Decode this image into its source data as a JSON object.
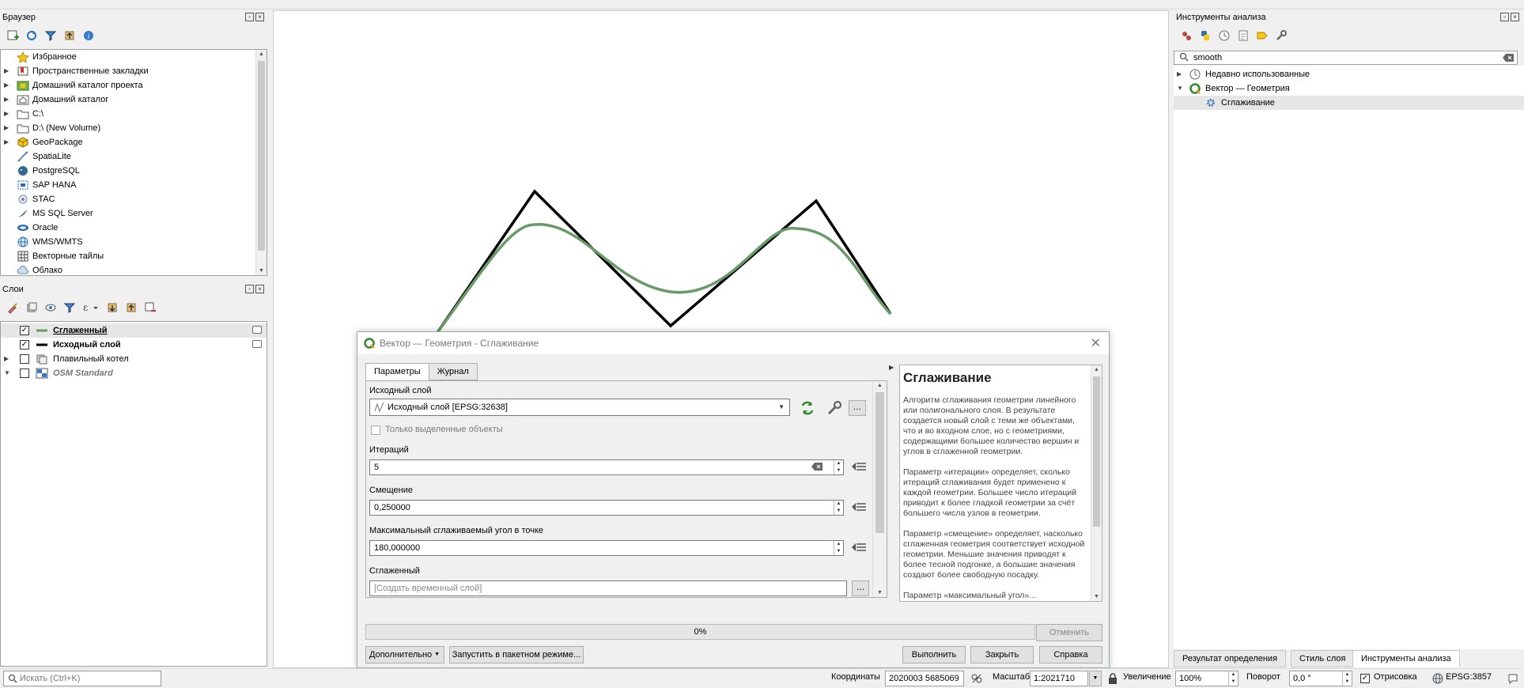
{
  "browser_panel": {
    "title": "Браузер",
    "items": [
      {
        "label": "Избранное",
        "icon": "star-icon",
        "arrow": ""
      },
      {
        "label": "Пространственные закладки",
        "icon": "bookmarks-icon",
        "arrow": "▶"
      },
      {
        "label": "Домашний каталог проекта",
        "icon": "project-home-icon",
        "arrow": "▶"
      },
      {
        "label": "Домашний каталог",
        "icon": "home-folder-icon",
        "arrow": "▶"
      },
      {
        "label": "C:\\",
        "icon": "folder-icon",
        "arrow": "▶"
      },
      {
        "label": "D:\\ (New Volume)",
        "icon": "folder-icon",
        "arrow": "▶"
      },
      {
        "label": "GeoPackage",
        "icon": "geopackage-icon",
        "arrow": "▶"
      },
      {
        "label": "SpatiaLite",
        "icon": "spatialite-icon",
        "arrow": ""
      },
      {
        "label": "PostgreSQL",
        "icon": "postgresql-icon",
        "arrow": ""
      },
      {
        "label": "SAP HANA",
        "icon": "sap-hana-icon",
        "arrow": ""
      },
      {
        "label": "STAC",
        "icon": "stac-icon",
        "arrow": ""
      },
      {
        "label": "MS SQL Server",
        "icon": "mssql-icon",
        "arrow": ""
      },
      {
        "label": "Oracle",
        "icon": "oracle-icon",
        "arrow": ""
      },
      {
        "label": "WMS/WMTS",
        "icon": "wms-icon",
        "arrow": ""
      },
      {
        "label": "Векторные тайлы",
        "icon": "vector-tiles-icon",
        "arrow": ""
      },
      {
        "label": "Облако",
        "icon": "cloud-icon",
        "arrow": ""
      }
    ]
  },
  "layers_panel": {
    "title": "Слои",
    "items": [
      {
        "label": "Сглаженный",
        "checked": true,
        "style": "smoothed"
      },
      {
        "label": "Исходный слой",
        "checked": true,
        "style": "source"
      },
      {
        "label": "Плавильный котел",
        "checked": false,
        "style": "group"
      },
      {
        "label": "OSM Standard",
        "checked": false,
        "style": "osm"
      }
    ]
  },
  "processing_panel": {
    "title": "Инструменты анализа",
    "search_value": "smooth",
    "tree": [
      {
        "label": "Недавно использованные",
        "arrow": "▶"
      },
      {
        "label": "Вектор — Геометрия",
        "arrow": "▼"
      },
      {
        "label": "Сглаживание",
        "arrow": ""
      }
    ]
  },
  "bottom_tabs": [
    "Результат определения",
    "Стиль слоя",
    "Инструменты анализа"
  ],
  "dialog": {
    "title": "Вектор — Геометрия - Сглаживание",
    "tabs": [
      "Параметры",
      "Журнал"
    ],
    "input_layer_label": "Исходный слой",
    "input_layer_value": "Исходный слой [EPSG:32638]",
    "selected_only_label": "Только выделенные объекты",
    "iterations_label": "Итераций",
    "iterations_value": "5",
    "offset_label": "Смещение",
    "offset_value": "0,250000",
    "max_angle_label": "Максимальный сглаживаемый угол в точке",
    "max_angle_value": "180,000000",
    "output_label": "Сглаженный",
    "output_placeholder": "[Создать временный слой]",
    "help_title": "Сглаживание",
    "help_p1": "Алгоритм сглаживания геометрии линейного или полигонального слоя. В результате создается новый слой с теми же объектами, что и во входном слое, но с геометриями, содержащими большее количество вершин и углов в сглаженной геометрии.",
    "help_p2": "Параметр «итерации» определяет, сколько итераций сглаживания будет применено к каждой геометрии. Большее число итераций приводит к более гладкой геометрии за счёт большего числа узлов в геометрии.",
    "help_p3": "Параметр «смещение» определяет, насколько сглаженная геометрия соответствует исходной геометрии. Меньшие значения приводят к более тесной подгонке, а большие значения создают более свободную посадку.",
    "help_p4": "Параметр «максимальный угол»...",
    "progress_text": "0%",
    "progress": 0,
    "cancel_label": "Отменить",
    "advanced_label": "Дополнительно",
    "batch_label": "Запустить в пакетном режиме...",
    "run_label": "Выполнить",
    "close_label": "Закрыть",
    "help_label": "Справка"
  },
  "statusbar": {
    "search_placeholder": "Искать (Ctrl+K)",
    "coords_label": "Координаты",
    "coords_value": "2020003  5685069",
    "scale_label": "Масштаб",
    "scale_value": "1:2021710",
    "magnifier_label": "Увеличение",
    "magnifier_value": "100%",
    "rotation_label": "Поворот",
    "rotation_value": "0,0 °",
    "render_label": "Отрисовка",
    "crs_label": "EPSG:3857"
  },
  "colors": {
    "smoothed_line": "#6a9a6a",
    "source_line": "#000000",
    "accent_green": "#2d8a2d"
  }
}
